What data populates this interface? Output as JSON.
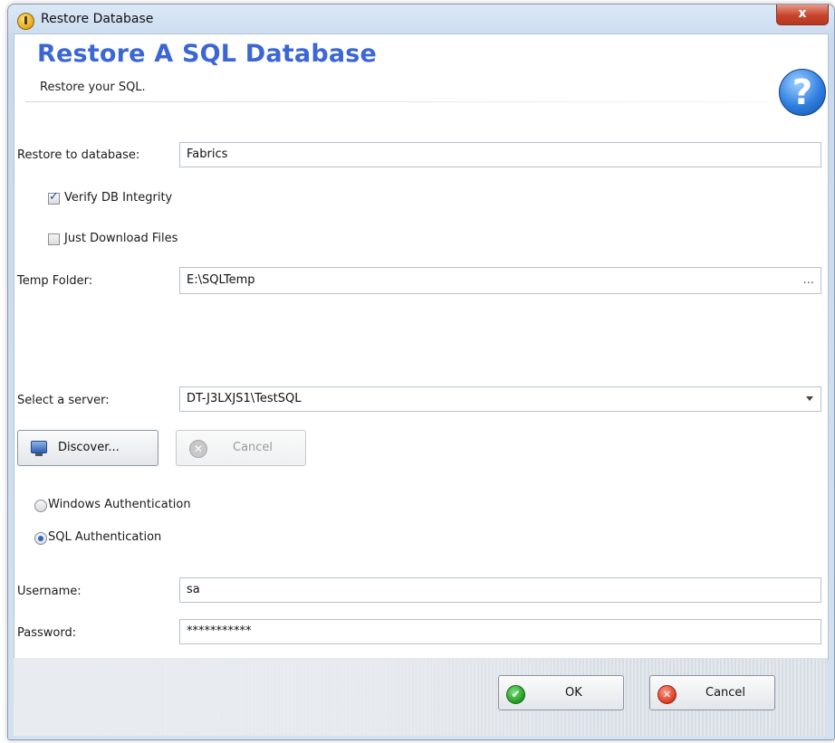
{
  "window": {
    "title": "Restore Database",
    "close_label": "x"
  },
  "header": {
    "heading": "Restore A SQL Database",
    "subheading": "Restore your SQL.",
    "help_glyph": "?"
  },
  "form": {
    "restore_to_label": "Restore to database:",
    "restore_to_value": "Fabrics",
    "verify_label": "Verify DB Integrity",
    "verify_checked": true,
    "download_label": "Just Download Files",
    "download_checked": false,
    "temp_folder_label": "Temp Folder:",
    "temp_folder_value": "E:\\SQLTemp",
    "temp_folder_browse": "...",
    "server_label": "Select a server:",
    "server_value": "DT-J3LXJS1\\TestSQL",
    "discover_label": "Discover...",
    "discover_cancel_label": "Cancel",
    "auth_windows_label": "Windows Authentication",
    "auth_sql_label": "SQL Authentication",
    "auth_selected": "SQL Authentication",
    "username_label": "Username:",
    "username_value": "sa",
    "password_label": "Password:",
    "password_value": "***********"
  },
  "footer": {
    "ok_label": "OK",
    "cancel_label": "Cancel"
  },
  "icons": {
    "app": "database-restore-icon",
    "help": "help-icon",
    "discover": "monitor-icon",
    "ok": "check-icon",
    "cancel": "cancel-icon"
  },
  "colors": {
    "heading": "#3b66d6",
    "close_button": "#c8452c",
    "ok_icon": "#1f9a1f",
    "cancel_icon": "#d83a20"
  }
}
